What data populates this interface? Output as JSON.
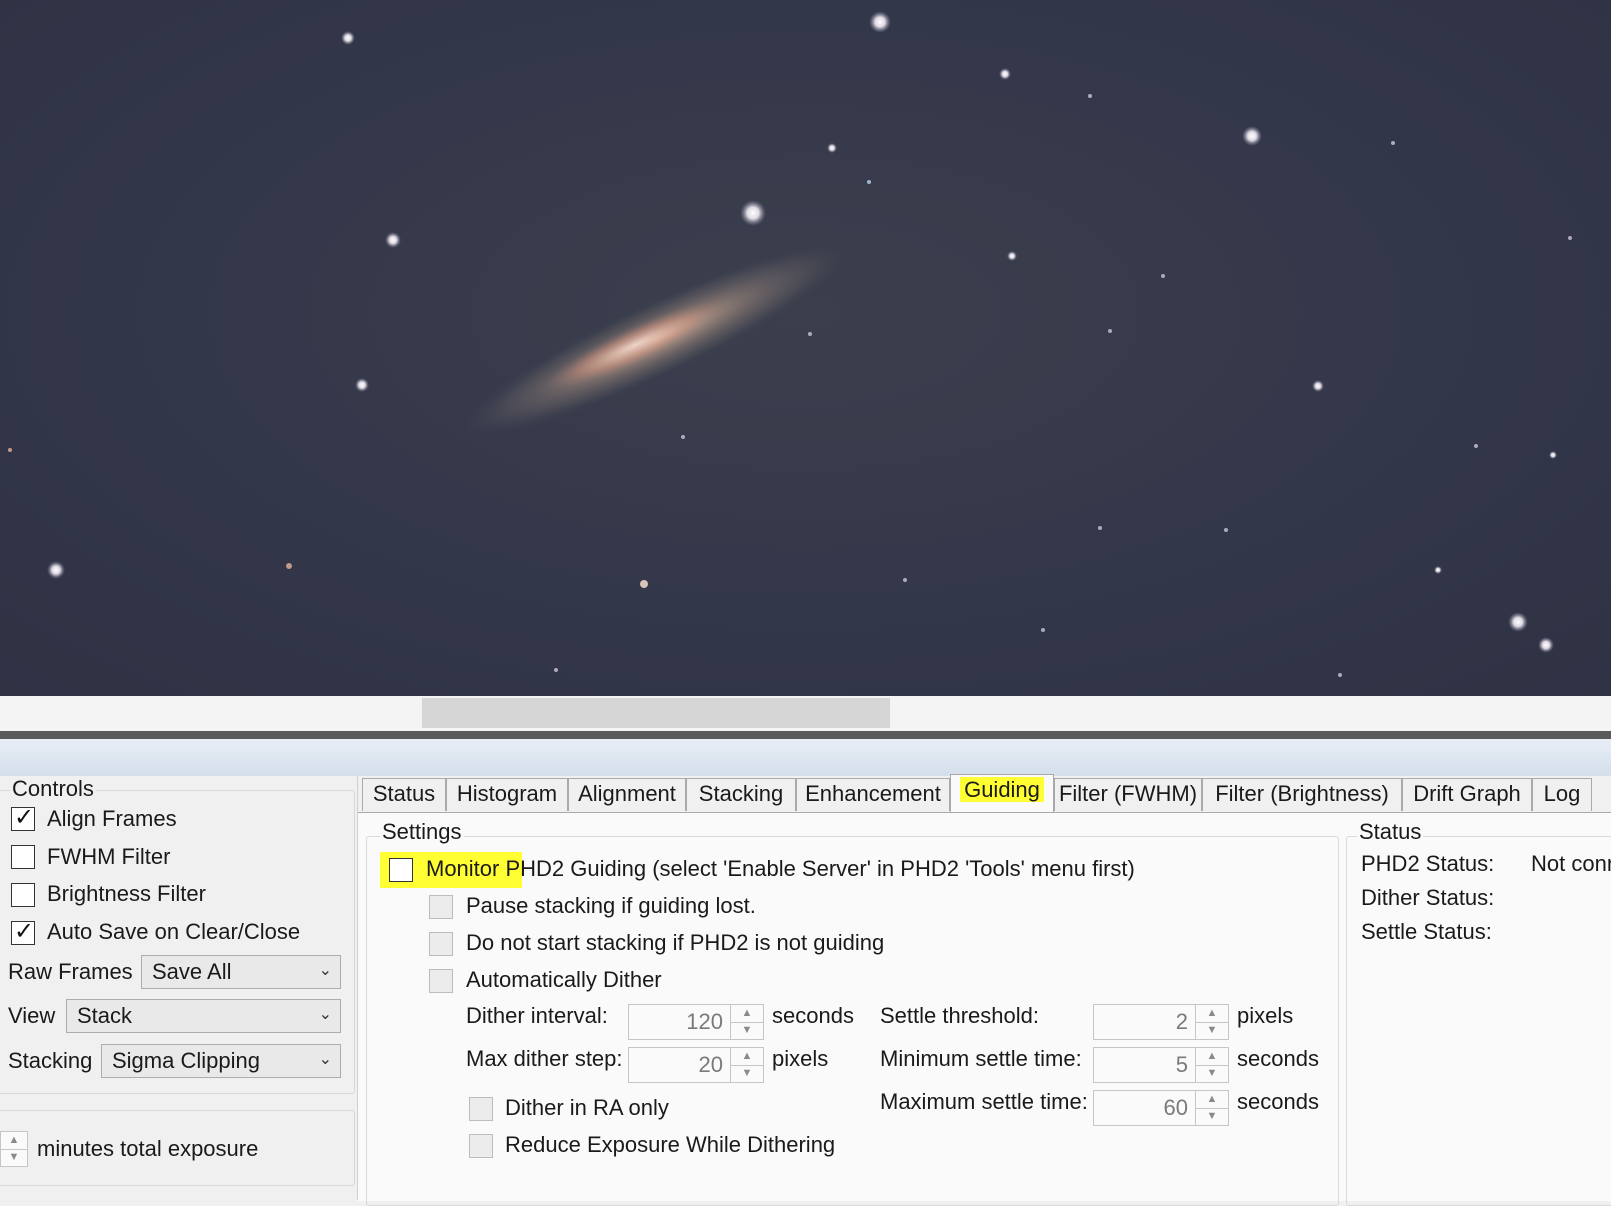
{
  "controls": {
    "title": "Controls",
    "checkboxes": [
      {
        "label": "Align Frames",
        "checked": true
      },
      {
        "label": "FWHM Filter",
        "checked": false
      },
      {
        "label": "Brightness Filter",
        "checked": false
      },
      {
        "label": "Auto Save on Clear/Close",
        "checked": true
      }
    ],
    "raw_frames": {
      "label": "Raw Frames",
      "value": "Save All"
    },
    "view": {
      "label": "View",
      "value": "Stack"
    },
    "stacking": {
      "label": "Stacking",
      "value": "Sigma Clipping"
    },
    "exposure_label": "minutes total exposure"
  },
  "tabs": [
    "Status",
    "Histogram",
    "Alignment",
    "Stacking",
    "Enhancement",
    "Guiding",
    "Filter (FWHM)",
    "Filter (Brightness)",
    "Drift Graph",
    "Log"
  ],
  "active_tab": "Guiding",
  "highlight_color": "#ffff33",
  "settings": {
    "title": "Settings",
    "monitor_label": "Monitor PHD2 Guiding (select 'Enable Server' in PHD2 'Tools' menu first)",
    "pause_label": "Pause stacking if guiding lost.",
    "no_start_label": "Do not start stacking if PHD2 is not guiding",
    "auto_dither_label": "Automatically Dither",
    "dither_interval": {
      "label": "Dither interval:",
      "value": "120",
      "unit": "seconds"
    },
    "max_dither_step": {
      "label": "Max dither step:",
      "value": "20",
      "unit": "pixels"
    },
    "settle_threshold": {
      "label": "Settle threshold:",
      "value": "2",
      "unit": "pixels"
    },
    "min_settle_time": {
      "label": "Minimum settle time:",
      "value": "5",
      "unit": "seconds"
    },
    "max_settle_time": {
      "label": "Maximum settle time:",
      "value": "60",
      "unit": "seconds"
    },
    "dither_ra_label": "Dither in RA only",
    "reduce_exposure_label": "Reduce Exposure While Dithering"
  },
  "status": {
    "title": "Status",
    "phd2_label": "PHD2 Status:",
    "phd2_value": "Not conn",
    "dither_label": "Dither Status:",
    "settle_label": "Settle Status:"
  }
}
